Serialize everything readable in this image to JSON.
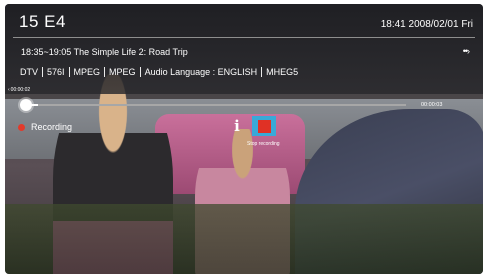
{
  "header": {
    "channel": "15  E4",
    "datetime": "18:41 2008/02/01 Fri"
  },
  "program": {
    "title": "18:35~19:05  The Simple Life 2: Road Trip",
    "more_icon": "more-arrow-icon"
  },
  "info": {
    "items": [
      "DTV",
      "576I",
      "MPEG",
      "MPEG",
      "Audio Language :  ENGLISH",
      "MHEG5"
    ]
  },
  "playback": {
    "start_time": "00:00:02",
    "end_time": "00:00:03",
    "progress": 0.02
  },
  "recording": {
    "status": "Recording",
    "stop_label": "Stop recording",
    "status_color": "#e23a2a"
  },
  "colors": {
    "accent": "#39a9d8",
    "record": "#e03125"
  }
}
